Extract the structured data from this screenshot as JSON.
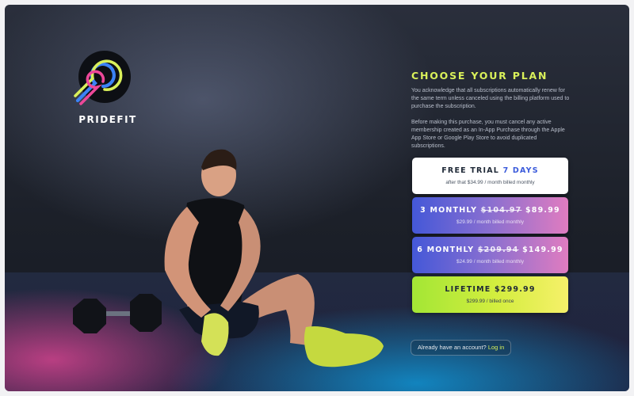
{
  "brand": {
    "name": "PRIDEFIT",
    "colors": {
      "yellow": "#d9f05a",
      "pink": "#ec4899",
      "blue": "#3b5bdb"
    }
  },
  "plan": {
    "title": "CHOOSE YOUR PLAN",
    "paragraph_1": "You acknowledge that all subscriptions automatically renew for the same term unless canceled using the billing platform used to purchase the subscription.",
    "paragraph_2": "Before making this purchase, you must cancel any active membership created as an In-App Purchase through the Apple App Store or Google Play Store to avoid duplicated subscriptions.",
    "options": [
      {
        "name": "FREE TRIAL",
        "highlight": "7 DAYS",
        "sub": "after that $34.99 / month billed monthly"
      },
      {
        "name": "3 MONTHLY",
        "old_price": "$104.97",
        "price": "$89.99",
        "sub": "$29.99 / month billed monthly"
      },
      {
        "name": "6 MONTHLY",
        "old_price": "$209.94",
        "price": "$149.99",
        "sub": "$24.99 / month billed monthly"
      },
      {
        "name": "LIFETIME",
        "price": "$299.99",
        "sub": "$299.99 / billed once"
      }
    ]
  },
  "login": {
    "prompt": "Already have an account?",
    "link_label": "Log in"
  },
  "icons": {
    "logo": "pridefit-logo-icon",
    "athlete": "athlete-tying-shoe-image",
    "dumbbell": "dumbbell-icon"
  }
}
